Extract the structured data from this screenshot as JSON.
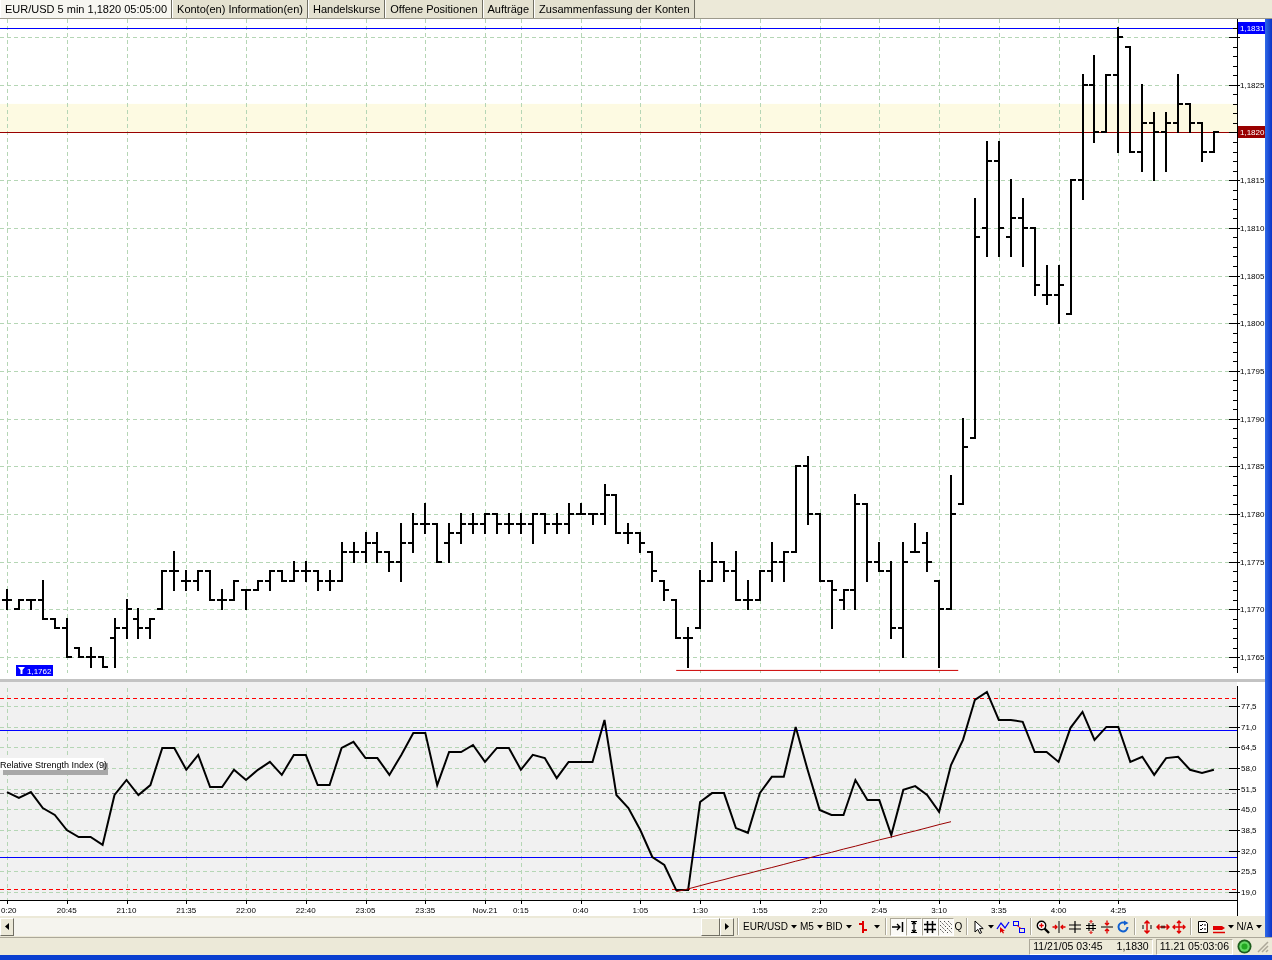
{
  "tabs": [
    {
      "label": "EUR/USD 5 min 1,1820 05:05:00",
      "selected": true
    },
    {
      "label": "Konto(en) Information(en)",
      "selected": false
    },
    {
      "label": "Handelskurse",
      "selected": false
    },
    {
      "label": "Offene Positionen",
      "selected": false
    },
    {
      "label": "Aufträge",
      "selected": false
    },
    {
      "label": "Zusammenfassung der Konten",
      "selected": false
    }
  ],
  "price_chart": {
    "axis_labels": [
      "1,1825",
      "1,1815",
      "1,1810",
      "1,1805",
      "1,1800",
      "1,1795",
      "1,1790",
      "1,1785",
      "1,1780",
      "1,1775",
      "1,1770",
      "1,1765"
    ],
    "price_tags": [
      {
        "label": "1,1831",
        "color": "#0000ff"
      },
      {
        "label": "1,1820",
        "color": "#990000"
      }
    ],
    "low_marker": "1,1762"
  },
  "rsi_chart": {
    "chart_data": {
      "type": "line",
      "grid": true,
      "ylim": [
        16.5,
        85
      ],
      "categories": [
        "0:20",
        null,
        null,
        null,
        null,
        "20:45",
        null,
        null,
        null,
        null,
        "21:10",
        null,
        null,
        null,
        null,
        "21:35",
        null,
        null,
        null,
        null,
        "22:00",
        null,
        null,
        null,
        null,
        "22:40",
        null,
        null,
        null,
        null,
        "23:05",
        null,
        null,
        null,
        null,
        "23:35",
        null,
        null,
        null,
        null,
        "Nov.21",
        null,
        null,
        "0:15",
        null,
        null,
        null,
        null,
        "0:40",
        null,
        null,
        null,
        null,
        "1:05",
        null,
        null,
        null,
        null,
        "1:30",
        null,
        null,
        null,
        null,
        "1:55",
        null,
        null,
        null,
        null,
        "2:20",
        null,
        null,
        null,
        null,
        "2:45",
        null,
        null,
        null,
        null,
        "3:10",
        null,
        null,
        null,
        null,
        "3:35",
        null,
        null,
        null,
        null,
        "4:00",
        null,
        null,
        null,
        null,
        "4:25",
        null,
        null,
        null,
        null,
        null,
        null,
        null,
        null
      ],
      "yticks": [
        {
          "value": 19,
          "label": "19,0"
        },
        {
          "value": 25.5,
          "label": "25,5"
        },
        {
          "value": 32,
          "label": "32,0"
        },
        {
          "value": 38.5,
          "label": "38,5"
        },
        {
          "value": 45,
          "label": "45,0"
        },
        {
          "value": 51.5,
          "label": "51,5"
        },
        {
          "value": 58,
          "label": "58,0"
        },
        {
          "value": 64.5,
          "label": "64,5"
        },
        {
          "value": 71,
          "label": "71,0"
        },
        {
          "value": 77.5,
          "label": "77,5"
        }
      ],
      "series": [
        {
          "name": "Relative Strength Index (9)",
          "color": "#000000",
          "values": [
            50.4,
            48.6,
            50.4,
            45.4,
            43.2,
            38.5,
            36.3,
            36.3,
            33.8,
            49.5,
            54.2,
            49.5,
            52.6,
            64.3,
            64.3,
            57.4,
            62.1,
            52.0,
            52.0,
            57.4,
            54.2,
            57.4,
            59.9,
            55.8,
            62.1,
            62.1,
            52.6,
            52.6,
            64.3,
            66.2,
            61.1,
            61.1,
            55.8,
            62.1,
            69.0,
            69.0,
            52.6,
            63.0,
            63.0,
            65.2,
            59.9,
            64.3,
            64.3,
            57.4,
            62.1,
            61.1,
            54.8,
            59.9,
            59.9,
            59.9,
            73.1,
            49.5,
            45.4,
            38.5,
            30.0,
            27.5,
            19.6,
            19.6,
            47.3,
            50.1,
            50.1,
            39.1,
            37.6,
            50.1,
            55.2,
            55.2,
            70.9,
            57.4,
            44.8,
            43.2,
            43.2,
            54.2,
            47.9,
            47.9,
            36.9,
            51.1,
            52.3,
            49.5,
            44.2,
            58.9,
            66.8,
            79.4,
            81.9,
            73.1,
            73.1,
            72.5,
            63.0,
            63.0,
            59.9,
            70.6,
            75.6,
            66.8,
            70.9,
            70.9,
            59.9,
            61.5,
            55.8,
            61.1,
            61.5,
            57.4,
            56.4,
            57.4
          ]
        },
        {
          "color": "#990000",
          "values": [
            null,
            null,
            null,
            null,
            null,
            null,
            null,
            null,
            null,
            null,
            null,
            null,
            null,
            null,
            null,
            null,
            null,
            null,
            null,
            null,
            null,
            null,
            null,
            null,
            null,
            null,
            null,
            null,
            null,
            null,
            null,
            null,
            null,
            null,
            null,
            null,
            null,
            null,
            null,
            null,
            null,
            null,
            null,
            null,
            null,
            null,
            null,
            null,
            null,
            null,
            null,
            null,
            null,
            null,
            null,
            null,
            19.1,
            20.0,
            21.0,
            22.0,
            22.9,
            23.9,
            24.8,
            25.8,
            26.7,
            27.7,
            28.7,
            29.6,
            30.6,
            31.5,
            32.5,
            33.4,
            34.4,
            35.4,
            36.3,
            37.3,
            38.2,
            39.2,
            40.2,
            41.1,
            null,
            null,
            null,
            null,
            null,
            null,
            null,
            null,
            null,
            null,
            null,
            null,
            null,
            null,
            null,
            null,
            null,
            null,
            null,
            null,
            null,
            null
          ]
        }
      ],
      "ref_lines": [
        {
          "axis": "y",
          "value": 80,
          "color": "#ff0000"
        },
        {
          "axis": "y",
          "value": 70,
          "color": "#0000ff"
        },
        {
          "axis": "y",
          "value": 50,
          "color": "#808080"
        },
        {
          "axis": "y",
          "value": 30,
          "color": "#0000ff"
        },
        {
          "axis": "y",
          "value": 20,
          "color": "#ff0000"
        }
      ]
    }
  },
  "toolbar": {
    "dropdowns": [
      {
        "label": "EUR/USD"
      },
      {
        "label": "M5"
      },
      {
        "label": "BID"
      }
    ],
    "toggles": [
      {
        "pressed": true
      },
      {
        "pressed": true
      },
      {
        "pressed": true
      },
      {
        "pressed": true
      }
    ],
    "text_button": "Q",
    "end_dropdown": {
      "label": "N/A"
    }
  },
  "status_bar": {
    "cursor_time": "11/21/05 03:45",
    "cursor_price": "1,1830",
    "clock": "11.21 05:03:06",
    "connected": true
  }
}
